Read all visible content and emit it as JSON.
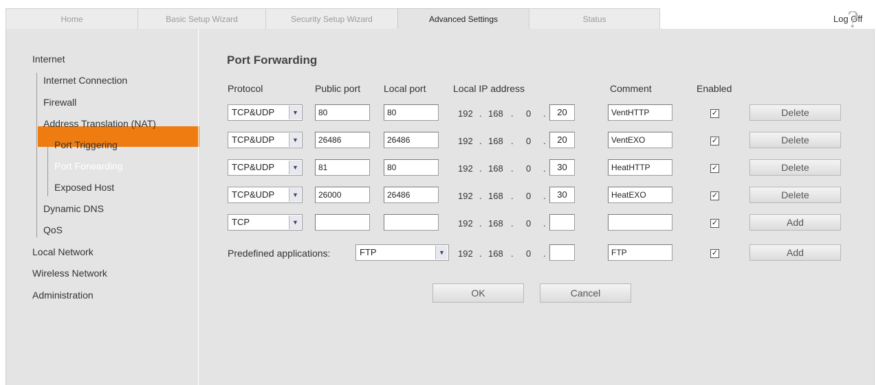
{
  "tabs": [
    "Home",
    "Basic Setup Wizard",
    "Security Setup Wizard",
    "Advanced Settings",
    "Status"
  ],
  "logoff": "Log Off",
  "help": "?",
  "sidebar": {
    "internet": "Internet",
    "internet_connection": "Internet Connection",
    "firewall": "Firewall",
    "nat": "Address Translation (NAT)",
    "port_triggering": "Port Triggering",
    "port_forwarding": "Port Forwarding",
    "exposed_host": "Exposed Host",
    "dynamic_dns": "Dynamic DNS",
    "qos": "QoS",
    "local_network": "Local Network",
    "wireless_network": "Wireless Network",
    "administration": "Administration"
  },
  "page": {
    "title": "Port Forwarding",
    "headers": {
      "protocol": "Protocol",
      "public_port": "Public port",
      "local_port": "Local port",
      "local_ip": "Local IP address",
      "comment": "Comment",
      "enabled": "Enabled"
    },
    "ip_prefix": [
      "192",
      "168",
      "0"
    ],
    "rows": [
      {
        "protocol": "TCP&UDP",
        "public": "80",
        "local": "80",
        "ip_last": "20",
        "comment": "VentHTTP",
        "enabled": "✓",
        "action": "Delete"
      },
      {
        "protocol": "TCP&UDP",
        "public": "26486",
        "local": "26486",
        "ip_last": "20",
        "comment": "VentEXO",
        "enabled": "✓",
        "action": "Delete"
      },
      {
        "protocol": "TCP&UDP",
        "public": "81",
        "local": "80",
        "ip_last": "30",
        "comment": "HeatHTTP",
        "enabled": "✓",
        "action": "Delete"
      },
      {
        "protocol": "TCP&UDP",
        "public": "26000",
        "local": "26486",
        "ip_last": "30",
        "comment": "HeatEXO",
        "enabled": "✓",
        "action": "Delete"
      },
      {
        "protocol": "TCP",
        "public": "",
        "local": "",
        "ip_last": "",
        "comment": "",
        "enabled": "✓",
        "action": "Add"
      }
    ],
    "predefined": {
      "label": "Predefined applications:",
      "value": "FTP",
      "ip_last": "",
      "comment": "FTP",
      "enabled": "✓",
      "action": "Add"
    },
    "ok": "OK",
    "cancel": "Cancel"
  },
  "colors": {
    "accent": "#ef7c10",
    "panel": "#e4e4e4"
  }
}
